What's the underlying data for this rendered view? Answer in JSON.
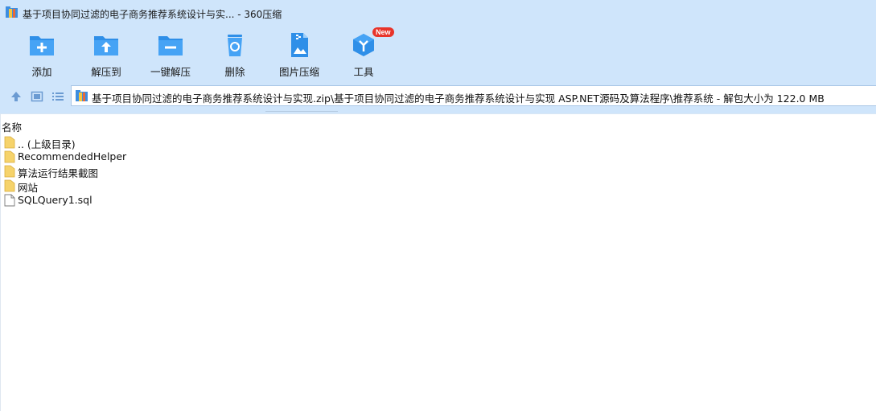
{
  "window": {
    "title": "基于项目协同过滤的电子商务推荐系统设计与实... - 360压缩"
  },
  "toolbar": {
    "add": "添加",
    "extract_to": "解压到",
    "one_click_extract": "一键解压",
    "delete": "删除",
    "image_compress": "图片压缩",
    "tools": "工具",
    "tools_badge": "New"
  },
  "address": {
    "path": "基于项目协同过滤的电子商务推荐系统设计与实现.zip\\基于项目协同过滤的电子商务推荐系统设计与实现 ASP.NET源码及算法程序\\推荐系统 - 解包大小为 122.0 MB"
  },
  "list": {
    "column_name": "名称",
    "items": [
      {
        "label": ".. (上级目录)",
        "type": "folder"
      },
      {
        "label": "RecommendedHelper",
        "type": "folder"
      },
      {
        "label": "算法运行结果截图",
        "type": "folder"
      },
      {
        "label": "网站",
        "type": "folder"
      },
      {
        "label": "SQLQuery1.sql",
        "type": "file"
      }
    ]
  },
  "colors": {
    "chrome_bg": "#cfe5fb",
    "icon_blue": "#2f8fe8",
    "folder_yellow": "#f6d36b",
    "badge_red": "#e8342a"
  }
}
